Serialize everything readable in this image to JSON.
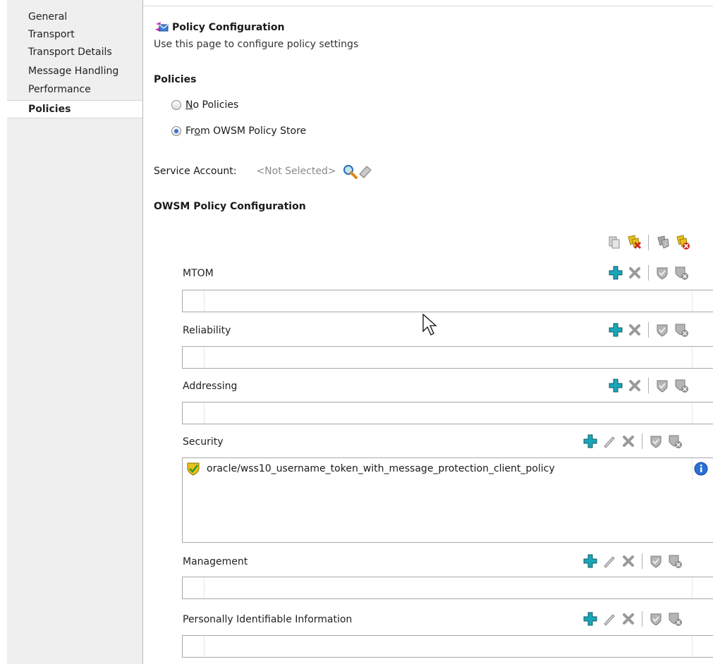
{
  "sidebar": {
    "items": [
      {
        "label": "General"
      },
      {
        "label": "Transport"
      },
      {
        "label": "Transport Details"
      },
      {
        "label": "Message Handling"
      },
      {
        "label": "Performance"
      },
      {
        "label": "Policies",
        "selected": true
      }
    ]
  },
  "header": {
    "title": "Policy Configuration",
    "subtitle": "Use this page to configure policy settings"
  },
  "policies": {
    "heading": "Policies",
    "option_none_prefix": "",
    "option_none_mnemonic": "N",
    "option_none_rest": "o Policies",
    "option_owsm_prefix": "Fr",
    "option_owsm_mnemonic": "o",
    "option_owsm_rest": "m OWSM Policy Store",
    "selected": "From OWSM Policy Store"
  },
  "service_account": {
    "label": "Service Account:",
    "value": "<Not Selected>"
  },
  "owsm": {
    "heading": "OWSM Policy Configuration",
    "sections": [
      {
        "label": "MTOM",
        "policies": []
      },
      {
        "label": "Reliability",
        "policies": []
      },
      {
        "label": "Addressing",
        "policies": []
      },
      {
        "label": "Security",
        "policies": [
          "oracle/wss10_username_token_with_message_protection_client_policy"
        ]
      },
      {
        "label": "Management",
        "policies": []
      },
      {
        "label": "Personally Identifiable Information",
        "policies": []
      }
    ]
  },
  "icons": {
    "title_icon": "policy-config-icon",
    "search": "search-icon",
    "clear": "eraser-icon",
    "add": "add-icon",
    "edit": "edit-icon",
    "delete": "delete-icon",
    "enable": "shield-check-icon",
    "disable": "shield-disable-icon",
    "policy": "shield-check-icon",
    "info": "info-icon"
  },
  "colors": {
    "add_icon": "#1aa6b8",
    "info_icon": "#2a6fd6",
    "shield_yellow": "#e8c21a"
  }
}
